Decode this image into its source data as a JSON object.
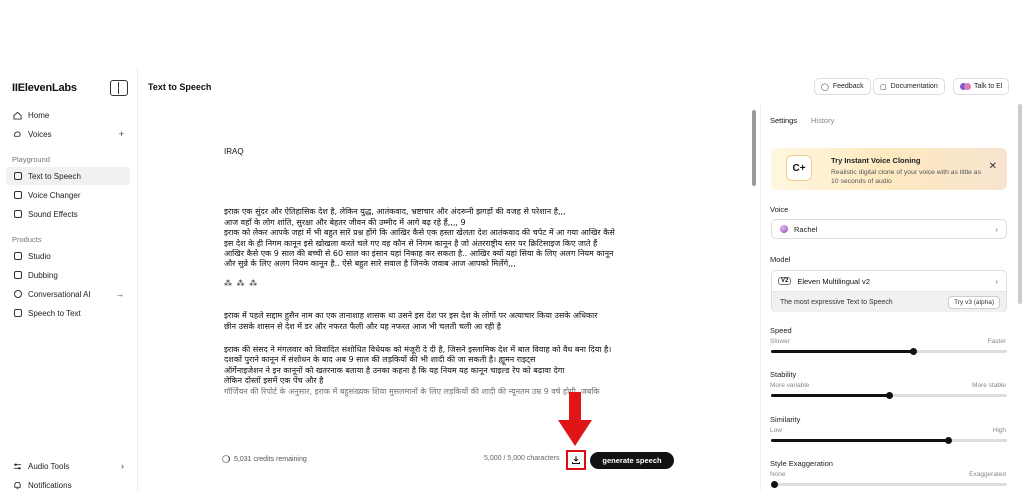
{
  "app": {
    "logo": "IIElevenLabs"
  },
  "sidebar": {
    "items_top": [
      {
        "label": "Home",
        "icon": "home-icon"
      },
      {
        "label": "Voices",
        "icon": "voices-icon",
        "extra": "+"
      }
    ],
    "playground_label": "Playground",
    "playground": [
      {
        "label": "Text to Speech",
        "active": true
      },
      {
        "label": "Voice Changer"
      },
      {
        "label": "Sound Effects"
      }
    ],
    "products_label": "Products",
    "products": [
      {
        "label": "Studio"
      },
      {
        "label": "Dubbing"
      },
      {
        "label": "Conversational AI",
        "extra": "→"
      },
      {
        "label": "Speech to Text"
      }
    ],
    "bottom": [
      {
        "label": "Audio Tools",
        "extra": "›"
      },
      {
        "label": "Notifications"
      }
    ]
  },
  "header": {
    "title": "Text to Speech",
    "feedback": "Feedback",
    "documentation": "Documentation",
    "talk": "Talk to El"
  },
  "editor": {
    "title": "IRAQ",
    "para1": [
      "इराक़ एक सुंदर और ऐतिहासिक देश है, लेकिन युद्ध, आतंकवाद, भ्रष्टाचार और अंदरूनी झगड़ों की वजह से परेशान है,,,",
      "आज वहाँ के लोग शांति, सुरक्षा और बेहतर जीवन की उम्मीद में आगे बढ़ रहे हैं,,,, 9",
      "इराक को लेकर आपके जहां में भी बहुत सारे प्रश्न होंगे कि आखिर कैसे एक हस्ता खेलता देश आतंकवाद की चपेट में आ गया आखिर कैसे",
      "इस देश के ही निगम कानून इसे खोखला करते चले गए वह कौन से निगम कानून है जो अंतरराष्ट्रीय स्तर पर क्रिटिसाइज किए जाते हैं",
      "आखिर कैसे एक 9 साल की बच्ची से 60 साल का इंसान यहां निकाह कर सकता है.. आखिर क्यों यहां सिया के लिए अलग नियम कानून",
      "और सुन्ने के लिए अलग नियम कानून है.. ऐसे बहुत सारे सवाल है जिनके जवाब आज आपको मिलेंगे,,,"
    ],
    "stars": "⁂ ⁂ ⁂",
    "para2": [
      "इराक में पहले सद्दाम हुसैन नाम का एक तानाशाह शासक था उसने इस देश पर इस देश के लोगों पर अत्याचार किया उसके अधिकार",
      "छीन उसके शासन से देश में डर और नफरत फैली और यह नफरत आज भी चलती चली आ रही है"
    ],
    "para3": [
      "इराक की संसद ने मंगलवार को विवादित संशोधित विधेयक को मंजूरी दे दी है, जिसने इस्लामिक देश में बाल विवाह को वैध बना दिया है।",
      "दशकों पुराने कानून में संशोधन के बाद अब 9 साल की लड़कियों की भी शादी की जा सकती है। ह्यूमन राइट्स",
      "ऑर्गेनाइजेशन ने इन कानूनों को खतरनाक बताया है उनका कहना है कि यह नियम यह कानून चाइल्ड रेप को बढ़ावा देगा",
      "लेकिन दोस्तों इसमें एक पेंच और है",
      "गॉर्जियन की रिपोर्ट के अनुसार, इराक में बहुसंख्यक शिया मुसलमानों के लिए लड़कियों की शादी की न्यूनतम उम्र 9 वर्ष होगी, जबकि"
    ]
  },
  "footer": {
    "credits": "5,031 credits remaining",
    "chars": "5,000 / 5,000 characters",
    "generate": "generate speech"
  },
  "panel": {
    "tab_settings": "Settings",
    "tab_history": "History",
    "promo_title": "Try Instant Voice Cloning",
    "promo_sub": "Realistic digital clone of your voice with as little as 10 seconds of audio",
    "voice_label": "Voice",
    "voice": "Rachel",
    "model_label": "Model",
    "model_badge": "V2",
    "model": "Eleven Multilingual v2",
    "model_tagline": "The most expressive Text to Speech",
    "try_v3": "Try v3 (alpha)",
    "sliders": [
      {
        "name": "Speed",
        "left": "Slower",
        "right": "Faster",
        "value": 0.6
      },
      {
        "name": "Stability",
        "left": "More variable",
        "right": "More stable",
        "value": 0.5
      },
      {
        "name": "Similarity",
        "left": "Low",
        "right": "High",
        "value": 0.75
      },
      {
        "name": "Style Exaggeration",
        "left": "None",
        "right": "Exaggerated",
        "value": 0.0
      }
    ]
  },
  "colors": {
    "highlight": "#d41010",
    "accent": "#111111"
  }
}
